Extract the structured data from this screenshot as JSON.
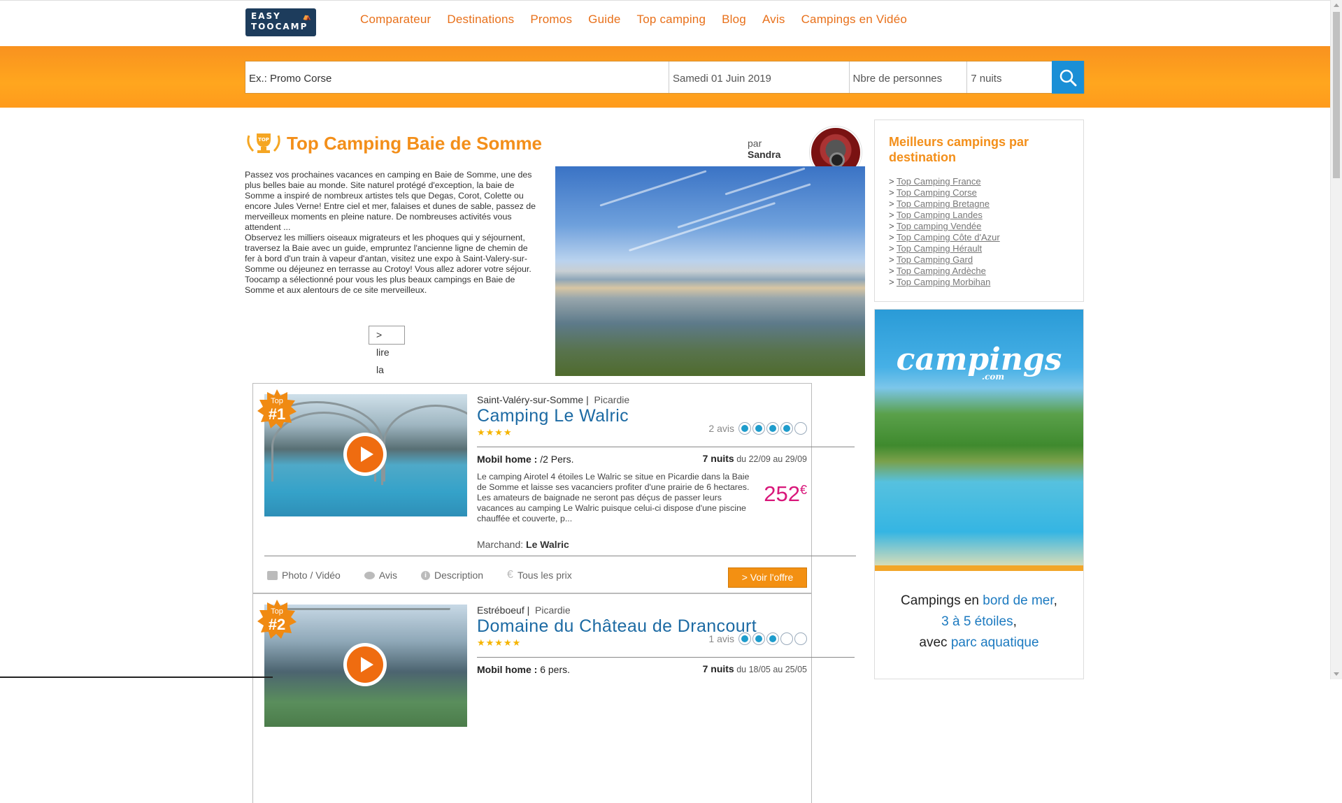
{
  "brand": {
    "logo_line1": "EASY",
    "logo_line2": "TOOCAMP"
  },
  "nav": [
    "Comparateur",
    "Destinations",
    "Promos",
    "Guide",
    "Top camping",
    "Blog",
    "Avis",
    "Campings en Vidéo"
  ],
  "search": {
    "query": "Ex.: Promo Corse",
    "date": "Samedi 01 Juin 2019",
    "persons": "Nbre de personnes",
    "nights": "7 nuits"
  },
  "page": {
    "title": "Top Camping Baie de Somme",
    "by_label": "par",
    "author": "Sandra",
    "intro": [
      "Passez vos prochaines vacances en camping en Baie de Somme, une des plus belles baie au monde. Site naturel protégé d'exception, la baie de Somme a inspiré de nombreux artistes tels que Degas, Corot, Colette ou encore Jules Verne! Entre ciel et mer, falaises et dunes de sable, passez de merveilleux moments en pleine nature. De nombreuses activités vous attendent ...",
      "Observez les milliers oiseaux migrateurs et les phoques qui y séjournent, traversez la Baie avec un guide, empruntez l'ancienne ligne de chemin de fer à bord d'un train à vapeur d'antan, visitez une expo à Saint-Valery-sur-Somme ou déjeunez en terrasse au Crotoy! Vous allez adorer votre séjour.",
      "Toocamp a sélectionné pour vous les plus beaux campings en Baie de Somme et aux alentours de ce site merveilleux."
    ],
    "read_more": "> lire la suite"
  },
  "campings": [
    {
      "badge_top": "Top",
      "badge_num": "#1",
      "city": "Saint-Valéry-sur-Somme",
      "region": "Picardie",
      "name": "Camping Le Walric",
      "stars": "★★★★",
      "reviews_label": "2 avis",
      "rating": 4,
      "rental_label": "Mobil home :",
      "rental_pers": "/2 Pers.",
      "nights": "7 nuits",
      "dates": "du 22/09 au 29/09",
      "desc": [
        "Le camping Airotel 4 étoiles Le Walric se situe en Picardie dans la Baie de Somme et laisse ses vacanciers profiter d'une prairie de 6 hectares.",
        "Les amateurs de baignade ne seront pas déçus de passer leurs vacances au camping Le Walric puisque celui-ci dispose d'une piscine chauffée et couverte, p..."
      ],
      "price": "252",
      "currency": "€",
      "merchant_label": "Marchand:",
      "merchant": "Le Walric",
      "actions": [
        "Photo / Vidéo",
        "Avis",
        "Description",
        "Tous les prix"
      ],
      "offer": "> Voir l'offre"
    },
    {
      "badge_top": "Top",
      "badge_num": "#2",
      "city": "Estréboeuf",
      "region": "Picardie",
      "name": "Domaine du Château de Drancourt",
      "stars": "★★★★★",
      "reviews_label": "1 avis",
      "rating": 3,
      "rental_label": "Mobil home :",
      "rental_pers": "6 pers.",
      "nights": "7 nuits",
      "dates": "du 18/05 au 25/05"
    }
  ],
  "sidebar": {
    "title": "Meilleurs campings par destination",
    "links": [
      "Top Camping France",
      "Top Camping Corse",
      "Top Camping Bretagne",
      "Top Camping Landes",
      "Top camping Vendée",
      "Top Camping Côte d'Azur",
      "Top Camping Hérault",
      "Top Camping Gard",
      "Top Camping Ardèche",
      "Top Camping Morbihan"
    ]
  },
  "ad": {
    "logo": "campings",
    "logo_com": ".com",
    "line1a": "Campings en ",
    "line1b": "bord de mer",
    "line1c": ",",
    "line2": "3 à 5 étoiles",
    "line2c": ",",
    "line3a": "avec ",
    "line3b": "parc aquatique"
  },
  "colors": {
    "accent": "#f38f1a",
    "link_blue": "#1c6aa3",
    "price": "#d8177a",
    "search_btn": "#1a8fd6"
  }
}
